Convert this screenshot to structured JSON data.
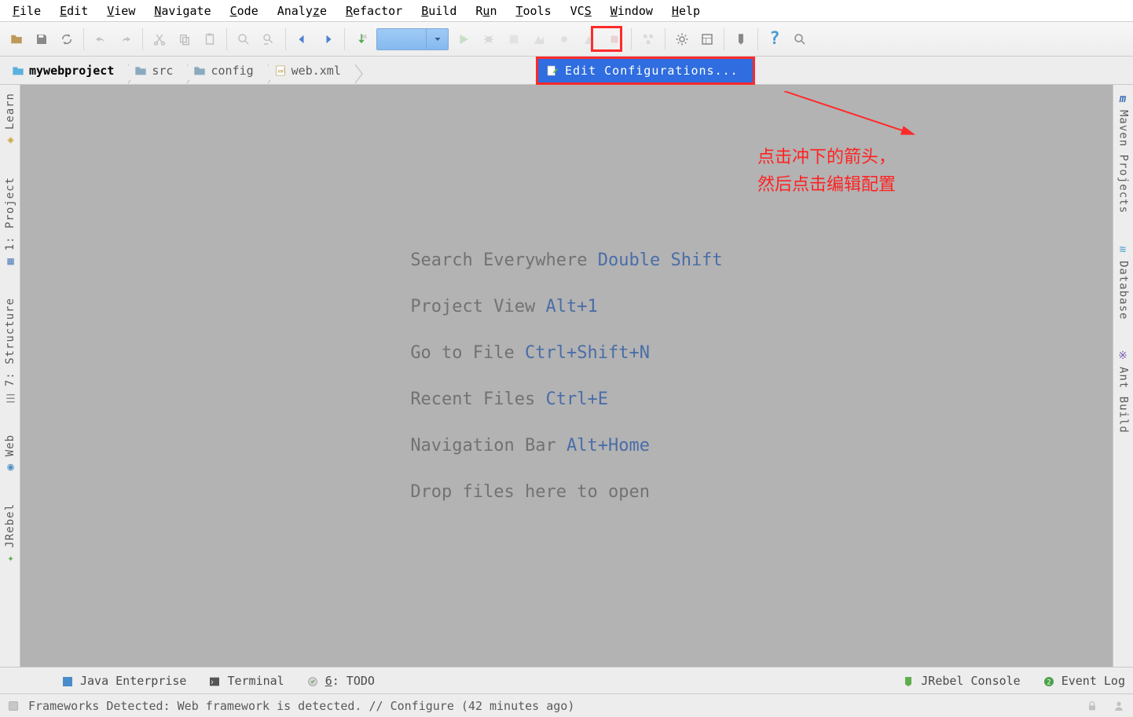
{
  "menubar": [
    "File",
    "Edit",
    "View",
    "Navigate",
    "Code",
    "Analyze",
    "Refactor",
    "Build",
    "Run",
    "Tools",
    "VCS",
    "Window",
    "Help"
  ],
  "breadcrumbs": [
    {
      "label": "mywebproject",
      "icon": "folder-root"
    },
    {
      "label": "src",
      "icon": "folder"
    },
    {
      "label": "config",
      "icon": "folder"
    },
    {
      "label": "web.xml",
      "icon": "xml-file"
    }
  ],
  "dropdown": {
    "label": "Edit Configurations..."
  },
  "annotation": {
    "line1": "点击冲下的箭头，",
    "line2": "然后点击编辑配置"
  },
  "hints": [
    {
      "text": "Search Everywhere ",
      "key": "Double Shift"
    },
    {
      "text": "Project View ",
      "key": "Alt+1"
    },
    {
      "text": "Go to File ",
      "key": "Ctrl+Shift+N"
    },
    {
      "text": "Recent Files ",
      "key": "Ctrl+E"
    },
    {
      "text": "Navigation Bar ",
      "key": "Alt+Home"
    },
    {
      "text": "Drop files here to open",
      "key": ""
    }
  ],
  "left_tabs": [
    {
      "label": "Learn",
      "icon": "◆"
    },
    {
      "label": "1: Project",
      "icon": "▦"
    },
    {
      "label": "7: Structure",
      "icon": "≡"
    },
    {
      "label": "Web",
      "icon": "◐"
    },
    {
      "label": "JRebel",
      "icon": "✦"
    }
  ],
  "right_tabs": [
    {
      "label": "Maven Projects",
      "icon": "m"
    },
    {
      "label": "Database",
      "icon": "≋"
    },
    {
      "label": "Ant Build",
      "icon": "※"
    }
  ],
  "bottom": {
    "java": "Java Enterprise",
    "terminal": "Terminal",
    "todo": "6: TODO",
    "jrebel": "JRebel Console",
    "eventlog": "Event Log"
  },
  "status": {
    "message": "Frameworks Detected: Web framework is detected. // Configure  (42 minutes ago)"
  }
}
